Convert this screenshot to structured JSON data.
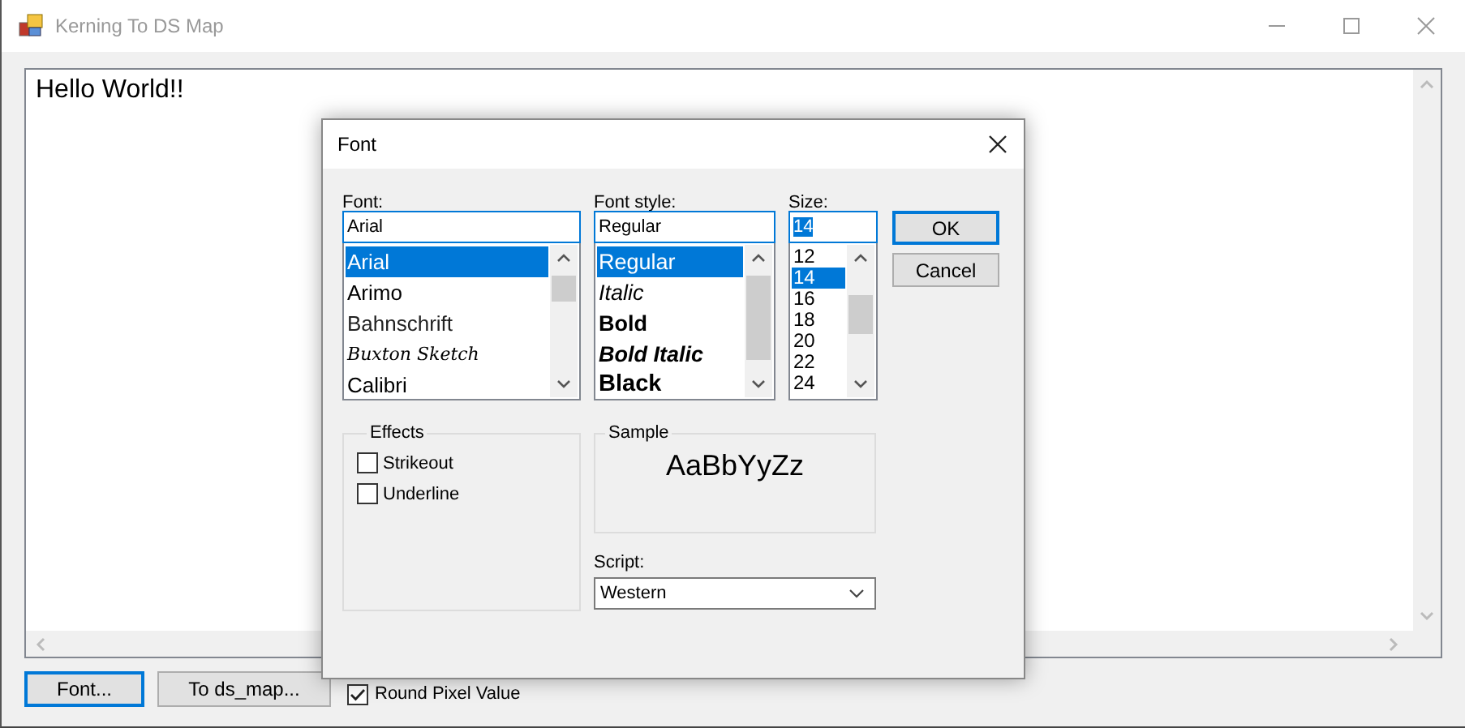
{
  "window": {
    "title": "Kerning To DS Map"
  },
  "editor": {
    "text": "Hello World!!"
  },
  "buttons": [
    {
      "label": "Font...",
      "focused": true
    },
    {
      "label": "To ds_map...",
      "focused": false
    }
  ],
  "round_pixel_value": {
    "label": "Round Pixel Value",
    "checked": true
  },
  "font_dialog": {
    "title": "Font",
    "font": {
      "label": "Font:",
      "value": "Arial",
      "items": [
        {
          "name": "Arial",
          "kind": "regular",
          "selected": true
        },
        {
          "name": "Arimo",
          "kind": "regular",
          "selected": false
        },
        {
          "name": "Bahnschrift",
          "kind": "light",
          "selected": false
        },
        {
          "name": "Buxton Sketch",
          "kind": "script",
          "selected": false
        },
        {
          "name": "Calibri",
          "kind": "regular",
          "selected": false
        }
      ]
    },
    "style": {
      "label": "Font style:",
      "value": "Regular",
      "items": [
        {
          "name": "Regular",
          "kind": "regular",
          "selected": true
        },
        {
          "name": "Italic",
          "kind": "italic",
          "selected": false
        },
        {
          "name": "Bold",
          "kind": "bold",
          "selected": false
        },
        {
          "name": "Bold Italic",
          "kind": "bold-italic",
          "selected": false
        },
        {
          "name": "Black",
          "kind": "black",
          "selected": false
        }
      ]
    },
    "size": {
      "label": "Size:",
      "value": "14",
      "items": [
        {
          "name": "12",
          "selected": false
        },
        {
          "name": "14",
          "selected": true
        },
        {
          "name": "16",
          "selected": false
        },
        {
          "name": "18",
          "selected": false
        },
        {
          "name": "20",
          "selected": false
        },
        {
          "name": "22",
          "selected": false
        },
        {
          "name": "24",
          "selected": false
        }
      ]
    },
    "buttons": [
      {
        "label": "OK",
        "focused": true
      },
      {
        "label": "Cancel",
        "focused": false
      }
    ],
    "effects": {
      "title": "Effects",
      "options": [
        {
          "label": "Strikeout",
          "checked": false
        },
        {
          "label": "Underline",
          "checked": false
        }
      ]
    },
    "sample": {
      "title": "Sample",
      "text": "AaBbYyZz"
    },
    "script": {
      "label": "Script:",
      "value": "Western"
    }
  }
}
